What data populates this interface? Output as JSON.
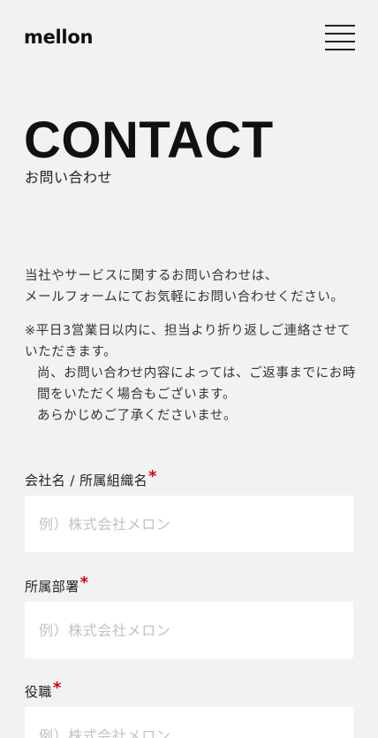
{
  "header": {
    "logo": "mellon",
    "menu_icon": "hamburger-menu-icon"
  },
  "hero": {
    "title": "CONTACT",
    "subtitle": "お問い合わせ"
  },
  "intro": {
    "line1": "当社やサービスに関するお問い合わせは、",
    "line2": "メールフォームにてお気軽にお問い合わせください。"
  },
  "notes": {
    "note1": "※平日3営業日以内に、担当より折り返しご連絡させていただきます。",
    "note2": "尚、お問い合わせ内容によっては、ご返事までにお時間をいただく場合もございます。",
    "note3": "あらかじめご了承くださいませ。"
  },
  "form": {
    "required_mark": "*",
    "fields": [
      {
        "label": "会社名 / 所属組織名",
        "placeholder": "例）株式会社メロン",
        "value": ""
      },
      {
        "label": "所属部署",
        "placeholder": "例）株式会社メロン",
        "value": ""
      },
      {
        "label": "役職",
        "placeholder": "例）株式会社メロン",
        "value": ""
      }
    ]
  },
  "colors": {
    "background": "#f2f2f2",
    "text": "#222222",
    "required": "#d0021b",
    "input_bg": "#ffffff",
    "placeholder": "#c2c2c2"
  }
}
